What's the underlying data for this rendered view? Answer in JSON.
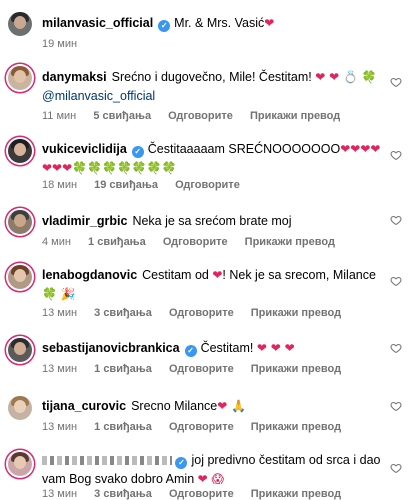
{
  "comments": [
    {
      "username": "milanvasic_official",
      "verified": true,
      "text": "Mr. & Mrs. Vasić",
      "emoji_text": "❤",
      "time": "19 мин",
      "likes": "",
      "reply": "",
      "translate": ""
    },
    {
      "username": "danymaksi",
      "verified": false,
      "text": "Srećno i dugovečno, Mile! Čestitam!",
      "emoji_text": "❤ ❤ 💍 🍀",
      "mention": "@milanvasic_official",
      "time": "11 мин",
      "likes": "5 свиђања",
      "reply": "Одговорите",
      "translate": "Прикажи превод"
    },
    {
      "username": "vukiceviclidija",
      "verified": true,
      "text": "Čestitaaaaam SREĆNOOOOOOO",
      "emoji_text": "❤❤❤❤❤❤❤🍀🍀🍀🍀🍀🍀🍀",
      "time": "18 мин",
      "likes": "19 свиђања",
      "reply": "Одговорите",
      "translate": ""
    },
    {
      "username": "vladimir_grbic",
      "verified": false,
      "text": "Neka je sa srećom brate moj",
      "emoji_text": "",
      "time": "4 мин",
      "likes": "1 свиђања",
      "reply": "Одговорите",
      "translate": "Прикажи превод"
    },
    {
      "username": "lenabogdanovic",
      "verified": false,
      "text_before": "Cestitam od",
      "emoji_mid": "❤",
      "text": "! Nek je sa srecom, Milance",
      "emoji_text": "🍀 🎉",
      "time": "13 мин",
      "likes": "3 свиђања",
      "reply": "Одговорите",
      "translate": "Прикажи превод"
    },
    {
      "username": "sebastijanovicbrankica",
      "verified": true,
      "text": "Čestitam!",
      "emoji_text": "❤ ❤ ❤",
      "time": "13 мин",
      "likes": "1 свиђања",
      "reply": "Одговорите",
      "translate": "Прикажи превод"
    },
    {
      "username": "tijana_curovic",
      "verified": false,
      "text": "Srecno Milance",
      "emoji_text": "❤ 🙏",
      "time": "13 мин",
      "likes": "1 свиђања",
      "reply": "Одговорите",
      "translate": "Прикажи превод"
    },
    {
      "username": "",
      "verified": true,
      "text": "joj predivno čestitam od srca i dao vam Bog svako dobro Amin",
      "emoji_text": "❤ 😱",
      "time": "13 мин",
      "likes": "3 свиђања",
      "reply": "Одговорите",
      "translate": "Прикажи превод"
    }
  ],
  "colors": {
    "heart": "#e0245e",
    "clover": "#2e9e3a",
    "verified": "#3897f0",
    "meta": "#737373",
    "story_ring": "#d62976"
  },
  "icons": {
    "like": "heart-outline-icon",
    "verified": "verified-badge-icon"
  }
}
